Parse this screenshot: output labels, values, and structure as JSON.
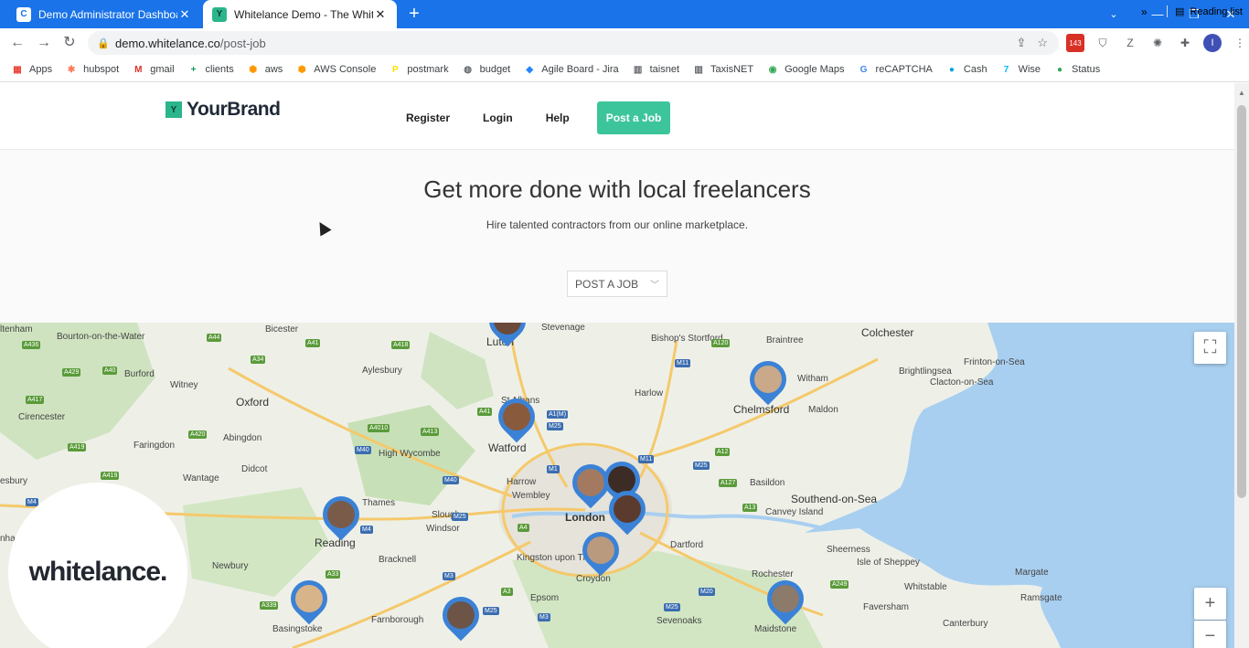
{
  "browser": {
    "tabs": [
      {
        "title": "Demo Administrator Dashboard",
        "favicon": "C",
        "active": false
      },
      {
        "title": "Whitelance Demo - The White La",
        "favicon": "Y",
        "active": true
      }
    ],
    "url_host": "demo.whitelance.co",
    "url_path": "/post-job",
    "profile_initial": "I",
    "calendar_badge": "143"
  },
  "bookmarks": [
    {
      "label": "Apps",
      "icon": "apps-grid",
      "color": "#ea4335"
    },
    {
      "label": "hubspot",
      "icon": "hubspot-logo",
      "color": "#ff7a59"
    },
    {
      "label": "gmail",
      "icon": "gmail-logo",
      "color": "#d93025"
    },
    {
      "label": "clients",
      "icon": "plus-box",
      "color": "#0f9d58"
    },
    {
      "label": "aws",
      "icon": "hex-cube",
      "color": "#ff9900"
    },
    {
      "label": "AWS Console",
      "icon": "hex-cube",
      "color": "#ff9900"
    },
    {
      "label": "postmark",
      "icon": "postmark-logo",
      "color": "#ffde00"
    },
    {
      "label": "budget",
      "icon": "globe",
      "color": "#5f6368"
    },
    {
      "label": "Agile Board - Jira",
      "icon": "jira-diamond",
      "color": "#2684ff"
    },
    {
      "label": "taisnet",
      "icon": "building",
      "color": "#5f6368"
    },
    {
      "label": "TaxisNET",
      "icon": "building",
      "color": "#5f6368"
    },
    {
      "label": "Google Maps",
      "icon": "map-pin",
      "color": "#34a853"
    },
    {
      "label": "reCAPTCHA",
      "icon": "google-g",
      "color": "#4285f4"
    },
    {
      "label": "Cash",
      "icon": "cash-logo",
      "color": "#00a1e0"
    },
    {
      "label": "Wise",
      "icon": "wise-logo",
      "color": "#00b9ff"
    },
    {
      "label": "Status",
      "icon": "status-dot",
      "color": "#34a853"
    }
  ],
  "reading_list": "Reading list",
  "site": {
    "brand": "YourBrand",
    "brand_mark": "Y",
    "nav": [
      "Register",
      "Login",
      "Help"
    ],
    "cta": "Post a Job",
    "accent": "#3cc59b"
  },
  "hero": {
    "title": "Get more done with local freelancers",
    "subtitle": "Hire talented contractors from our online marketplace.",
    "dropdown": "POST A JOB"
  },
  "map": {
    "logo": "whitelance.",
    "places": [
      {
        "name": "ltenham",
        "cls": ""
      },
      {
        "name": "Bourton-on-the-Water",
        "cls": ""
      },
      {
        "name": "Bicester",
        "cls": ""
      },
      {
        "name": "Luton",
        "cls": "big"
      },
      {
        "name": "Stevenage",
        "cls": ""
      },
      {
        "name": "Bishop's Stortford",
        "cls": ""
      },
      {
        "name": "Braintree",
        "cls": ""
      },
      {
        "name": "Colchester",
        "cls": "big"
      },
      {
        "name": "Burford",
        "cls": ""
      },
      {
        "name": "Witney",
        "cls": ""
      },
      {
        "name": "Aylesbury",
        "cls": ""
      },
      {
        "name": "Witham",
        "cls": ""
      },
      {
        "name": "Brightlingsea",
        "cls": ""
      },
      {
        "name": "Frinton-on-Sea",
        "cls": ""
      },
      {
        "name": "Clacton-on-Sea",
        "cls": ""
      },
      {
        "name": "Oxford",
        "cls": "big"
      },
      {
        "name": "Harlow",
        "cls": ""
      },
      {
        "name": "Chelmsford",
        "cls": "big"
      },
      {
        "name": "Maldon",
        "cls": ""
      },
      {
        "name": "Cirencester",
        "cls": ""
      },
      {
        "name": "St Albans",
        "cls": ""
      },
      {
        "name": "Abingdon",
        "cls": ""
      },
      {
        "name": "Faringdon",
        "cls": ""
      },
      {
        "name": "Watford",
        "cls": "big"
      },
      {
        "name": "High Wycombe",
        "cls": ""
      },
      {
        "name": "Didcot",
        "cls": ""
      },
      {
        "name": "Wantage",
        "cls": ""
      },
      {
        "name": "Harrow",
        "cls": ""
      },
      {
        "name": "Wembley",
        "cls": ""
      },
      {
        "name": "Basildon",
        "cls": ""
      },
      {
        "name": "Southend-on-Sea",
        "cls": "big"
      },
      {
        "name": "Canvey Island",
        "cls": ""
      },
      {
        "name": "esbury",
        "cls": ""
      },
      {
        "name": "Thames",
        "cls": ""
      },
      {
        "name": "Slough",
        "cls": ""
      },
      {
        "name": "Windsor",
        "cls": ""
      },
      {
        "name": "London",
        "cls": "bold"
      },
      {
        "name": "Reading",
        "cls": "big"
      },
      {
        "name": "Dartford",
        "cls": ""
      },
      {
        "name": "Bracknell",
        "cls": ""
      },
      {
        "name": "Kingston upon Thames",
        "cls": ""
      },
      {
        "name": "Croydon",
        "cls": ""
      },
      {
        "name": "Sheerness",
        "cls": ""
      },
      {
        "name": "Isle of Sheppey",
        "cls": ""
      },
      {
        "name": "Margate",
        "cls": ""
      },
      {
        "name": "Newbury",
        "cls": ""
      },
      {
        "name": "Rochester",
        "cls": ""
      },
      {
        "name": "Whitstable",
        "cls": ""
      },
      {
        "name": "Ramsgate",
        "cls": ""
      },
      {
        "name": "Epsom",
        "cls": ""
      },
      {
        "name": "Faversham",
        "cls": ""
      },
      {
        "name": "Basingstoke",
        "cls": ""
      },
      {
        "name": "Farnborough",
        "cls": ""
      },
      {
        "name": "Sevenoaks",
        "cls": ""
      },
      {
        "name": "Maidstone",
        "cls": ""
      },
      {
        "name": "Canterbury",
        "cls": ""
      },
      {
        "name": "nha",
        "cls": ""
      }
    ],
    "roads": [
      {
        "label": "A436",
        "type": "a"
      },
      {
        "label": "A44",
        "type": "a"
      },
      {
        "label": "A41",
        "type": "a"
      },
      {
        "label": "A418",
        "type": "a"
      },
      {
        "label": "A120",
        "type": "a"
      },
      {
        "label": "A429",
        "type": "a"
      },
      {
        "label": "A40",
        "type": "a"
      },
      {
        "label": "A34",
        "type": "a"
      },
      {
        "label": "M11",
        "type": "m"
      },
      {
        "label": "A417",
        "type": "a"
      },
      {
        "label": "A4010",
        "type": "a"
      },
      {
        "label": "A413",
        "type": "a"
      },
      {
        "label": "A41",
        "type": "a"
      },
      {
        "label": "A1(M)",
        "type": "m"
      },
      {
        "label": "M25",
        "type": "m"
      },
      {
        "label": "A420",
        "type": "a"
      },
      {
        "label": "A419",
        "type": "a"
      },
      {
        "label": "M40",
        "type": "m"
      },
      {
        "label": "M11",
        "type": "m"
      },
      {
        "label": "A12",
        "type": "a"
      },
      {
        "label": "M1",
        "type": "m"
      },
      {
        "label": "M25",
        "type": "m"
      },
      {
        "label": "A419",
        "type": "a"
      },
      {
        "label": "M40",
        "type": "m"
      },
      {
        "label": "A127",
        "type": "a"
      },
      {
        "label": "M4",
        "type": "m"
      },
      {
        "label": "A13",
        "type": "a"
      },
      {
        "label": "M25",
        "type": "m"
      },
      {
        "label": "M4",
        "type": "m"
      },
      {
        "label": "A4",
        "type": "a"
      },
      {
        "label": "A33",
        "type": "a"
      },
      {
        "label": "M3",
        "type": "m"
      },
      {
        "label": "M20",
        "type": "m"
      },
      {
        "label": "A249",
        "type": "a"
      },
      {
        "label": "A3",
        "type": "a"
      },
      {
        "label": "A339",
        "type": "a"
      },
      {
        "label": "M25",
        "type": "m"
      },
      {
        "label": "M25",
        "type": "m"
      },
      {
        "label": "M3",
        "type": "m"
      }
    ],
    "pins": [
      {
        "initials": "",
        "color": "#6b4a3a"
      },
      {
        "initials": "",
        "color": "#8a5a3c"
      },
      {
        "initials": "",
        "color": "#c9a98a"
      },
      {
        "initials": "",
        "color": "#7a5b4a"
      },
      {
        "initials": "",
        "color": "#a37a60"
      },
      {
        "initials": "",
        "color": "#3d2b25"
      },
      {
        "initials": "",
        "color": "#5b3b2d"
      },
      {
        "initials": "",
        "color": "#b99a7f"
      },
      {
        "initials": "",
        "color": "#d8b48a"
      },
      {
        "initials": "",
        "color": "#6e5446"
      },
      {
        "initials": "",
        "color": "#8c7a6a"
      }
    ]
  }
}
